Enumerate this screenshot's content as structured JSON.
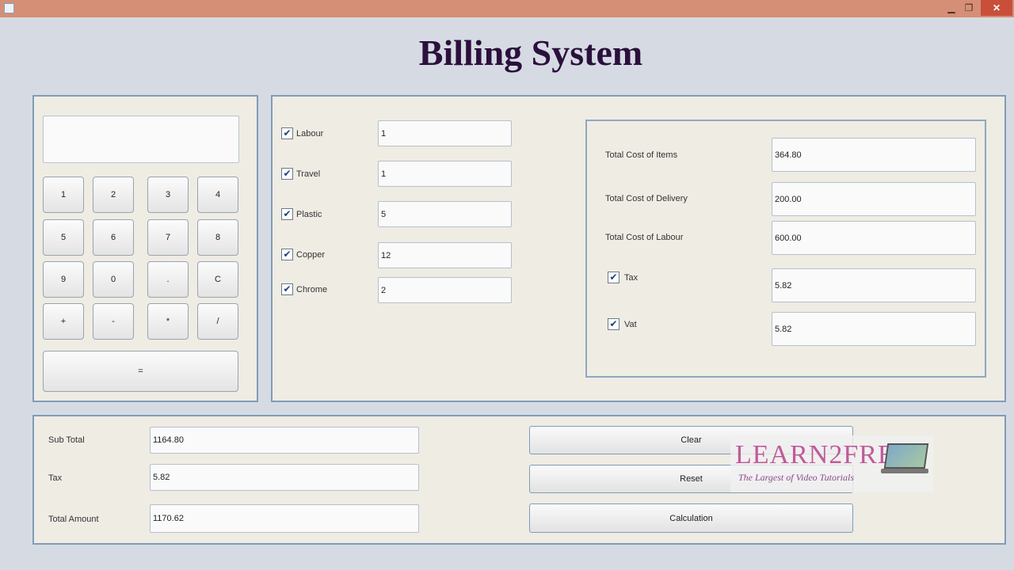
{
  "window": {
    "min_glyph": "▁",
    "max_glyph": "❐",
    "close_glyph": "✕"
  },
  "title": "Billing System",
  "calculator": {
    "display_value": "",
    "keys": [
      "1",
      "2",
      "3",
      "4",
      "5",
      "6",
      "7",
      "8",
      "9",
      "0",
      ".",
      "C",
      "+",
      "-",
      "*",
      "/"
    ],
    "equals": "="
  },
  "items": [
    {
      "label": "Labour",
      "checked": true,
      "value": "1"
    },
    {
      "label": "Travel",
      "checked": true,
      "value": "1"
    },
    {
      "label": "Plastic",
      "checked": true,
      "value": "5"
    },
    {
      "label": "Copper",
      "checked": true,
      "value": "12"
    },
    {
      "label": "Chrome",
      "checked": true,
      "value": "2"
    }
  ],
  "costs": {
    "items_label": "Total Cost of Items",
    "items_value": "364.80",
    "delivery_label": "Total Cost of Delivery",
    "delivery_value": "200.00",
    "labour_label": "Total Cost of Labour",
    "labour_value": "600.00",
    "tax_label": "Tax",
    "tax_checked": true,
    "tax_value": "5.82",
    "vat_label": "Vat",
    "vat_checked": true,
    "vat_value": "5.82"
  },
  "summary": {
    "subtotal_label": "Sub Total",
    "subtotal_value": "1164.80",
    "tax_label": "Tax",
    "tax_value": "5.82",
    "total_label": "Total Amount",
    "total_value": "1170.62"
  },
  "buttons": {
    "clear": "Clear",
    "reset": "Reset",
    "calculation": "Calculation"
  },
  "watermark": {
    "brand": "LEARN2FREE",
    "tagline": "The Largest of Video Tutorials"
  },
  "check_glyph": "✔"
}
